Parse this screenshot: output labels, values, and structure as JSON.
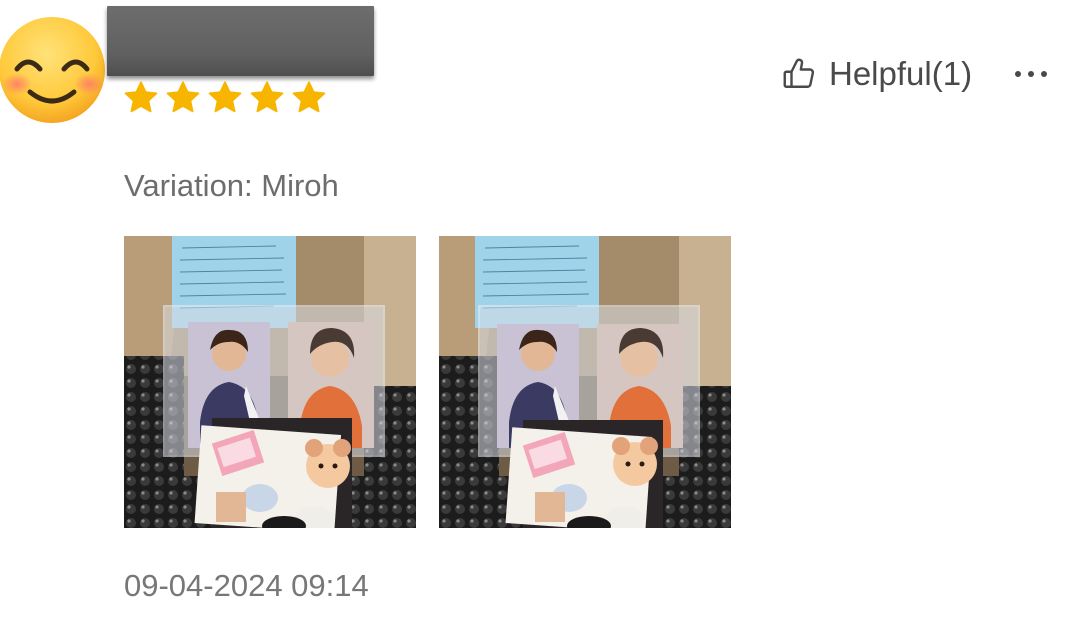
{
  "reviewer": {
    "avatar_icon": "smiling-face-emoji-icon",
    "rating": 5,
    "rating_max": 5
  },
  "actions": {
    "helpful_label": "Helpful(1)",
    "helpful_icon": "thumbs-up-outline-icon",
    "more_icon": "more-horizontal-icon"
  },
  "review": {
    "variation": "Variation: Miroh",
    "timestamp": "09-04-2024 09:14"
  },
  "colors": {
    "star": "#F7B500",
    "text_primary": "#4a4a4a",
    "text_secondary": "#6d6d6d"
  }
}
